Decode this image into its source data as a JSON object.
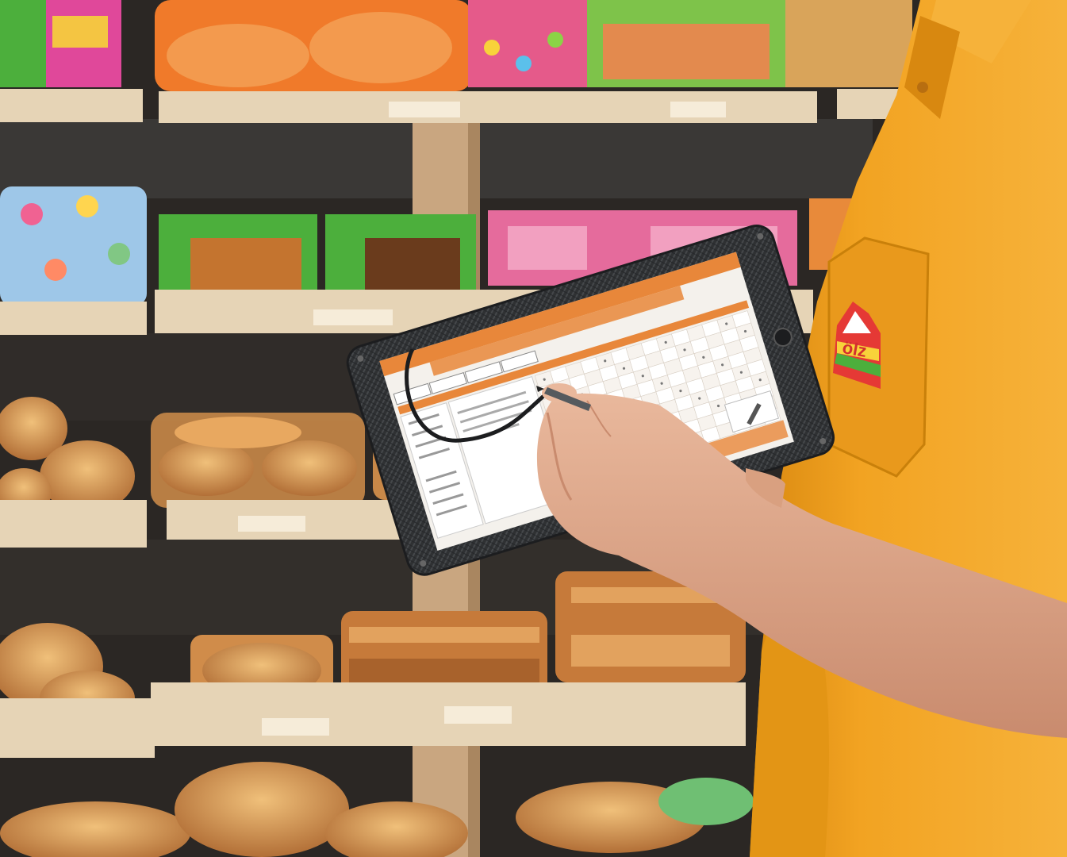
{
  "scene": {
    "colors": {
      "shelf_wall": "#2b2724",
      "shelf_board": "#e6d4b6",
      "shelf_post": "#c9a680",
      "bread": "#d89a55",
      "bread_dark": "#a8622c",
      "wrapper_orange": "#f07a2a",
      "wrapper_green": "#4caf3c",
      "wrapper_pink": "#e0489a",
      "shirt": "#f2a322",
      "shirt_shadow": "#d88810",
      "skin": "#e8b497",
      "skin_shadow": "#c98b6e",
      "case_carbon": "#2f3133",
      "screen_bg": "#f4f1ec",
      "app_accent": "#e8873a"
    },
    "tablet": {
      "app_header_title": "",
      "app_date": "",
      "app_tabs": [
        "",
        "",
        "",
        ""
      ]
    },
    "shirt_logo": {
      "text": "ölz",
      "icon": "mountain-logo-icon"
    }
  }
}
